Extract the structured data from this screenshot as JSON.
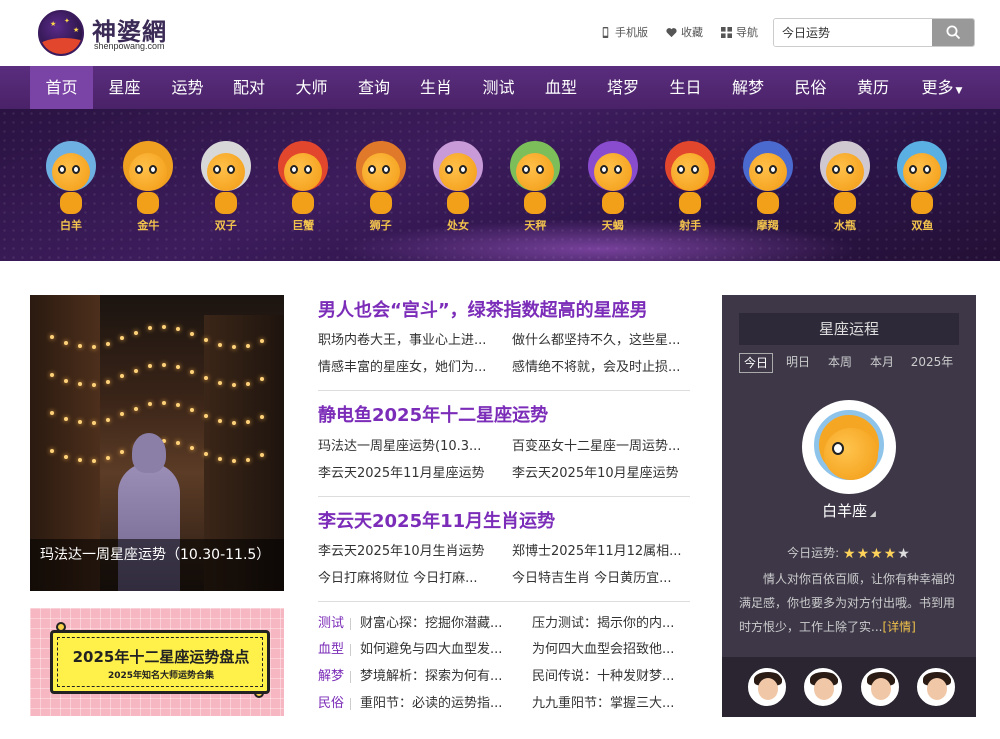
{
  "header": {
    "logo_title": "神婆網",
    "logo_subtitle": "shenpowang.com",
    "links": [
      {
        "label": "手机版",
        "icon": "phone-icon"
      },
      {
        "label": "收藏",
        "icon": "heart-icon"
      },
      {
        "label": "导航",
        "icon": "grid-icon"
      }
    ],
    "search": {
      "value": "今日运势",
      "icon": "search-icon"
    }
  },
  "nav": {
    "items": [
      "首页",
      "星座",
      "运势",
      "配对",
      "大师",
      "查询",
      "生肖",
      "测试",
      "血型",
      "塔罗",
      "生日",
      "解梦",
      "民俗",
      "黄历",
      "更多"
    ],
    "active_index": 0
  },
  "zodiac": [
    "白羊",
    "金牛",
    "双子",
    "巨蟹",
    "狮子",
    "处女",
    "天秤",
    "天蝎",
    "射手",
    "摩羯",
    "水瓶",
    "双鱼"
  ],
  "feature": {
    "caption": "玛法达一周星座运势（10.30-11.5）"
  },
  "promo": {
    "title": "2025年十二星座运势盘点",
    "subtitle": "2025年知名大师运势合集"
  },
  "sections": [
    {
      "title": "男人也会“宫斗”，绿茶指数超高的星座男",
      "rows": [
        [
          "职场内卷大王，事业心上进...",
          "做什么都坚持不久，这些星..."
        ],
        [
          "情感丰富的星座女，她们为...",
          "感情绝不将就，会及时止损..."
        ]
      ]
    },
    {
      "title": "静电鱼2025年十二星座运势",
      "rows": [
        [
          "玛法达一周星座运势(10.3...",
          "百变巫女十二星座一周运势..."
        ],
        [
          "李云天2025年11月星座运势",
          "李云天2025年10月星座运势"
        ]
      ]
    },
    {
      "title": "李云天2025年11月生肖运势",
      "rows": [
        [
          "李云天2025年10月生肖运势",
          "郑博士2025年11月12属相..."
        ],
        [
          "今日打麻将财位 今日打麻...",
          "今日特吉生肖 今日黄历宜..."
        ]
      ]
    }
  ],
  "categories": [
    {
      "cat": "测试",
      "a": "财富心探：挖掘你潜藏...",
      "b": "压力测试：揭示你的内..."
    },
    {
      "cat": "血型",
      "a": "如何避免与四大血型发...",
      "b": "为何四大血型会招致他..."
    },
    {
      "cat": "解梦",
      "a": "梦境解析：探索为何有...",
      "b": "民间传说：十种发财梦..."
    },
    {
      "cat": "民俗",
      "a": "重阳节：必读的运势指...",
      "b": "九九重阳节：掌握三大..."
    }
  ],
  "panel": {
    "title": "星座运程",
    "tabs": [
      "今日",
      "明日",
      "本周",
      "本月",
      "2025年"
    ],
    "active_tab": 0,
    "sign": "白羊座",
    "fortune_label": "今日运势:",
    "stars_on": 4,
    "stars_total": 5,
    "description": "情人对你百依百顺，让你有种幸福的满足感，你也要多为对方付出哦。书到用时方恨少，工作上除了实...",
    "more": "[详情]"
  },
  "colors": {
    "nav": "#4f2570",
    "nav_active": "#7a43a6",
    "accent": "#7b2cb8",
    "panel": "#3d3748"
  }
}
